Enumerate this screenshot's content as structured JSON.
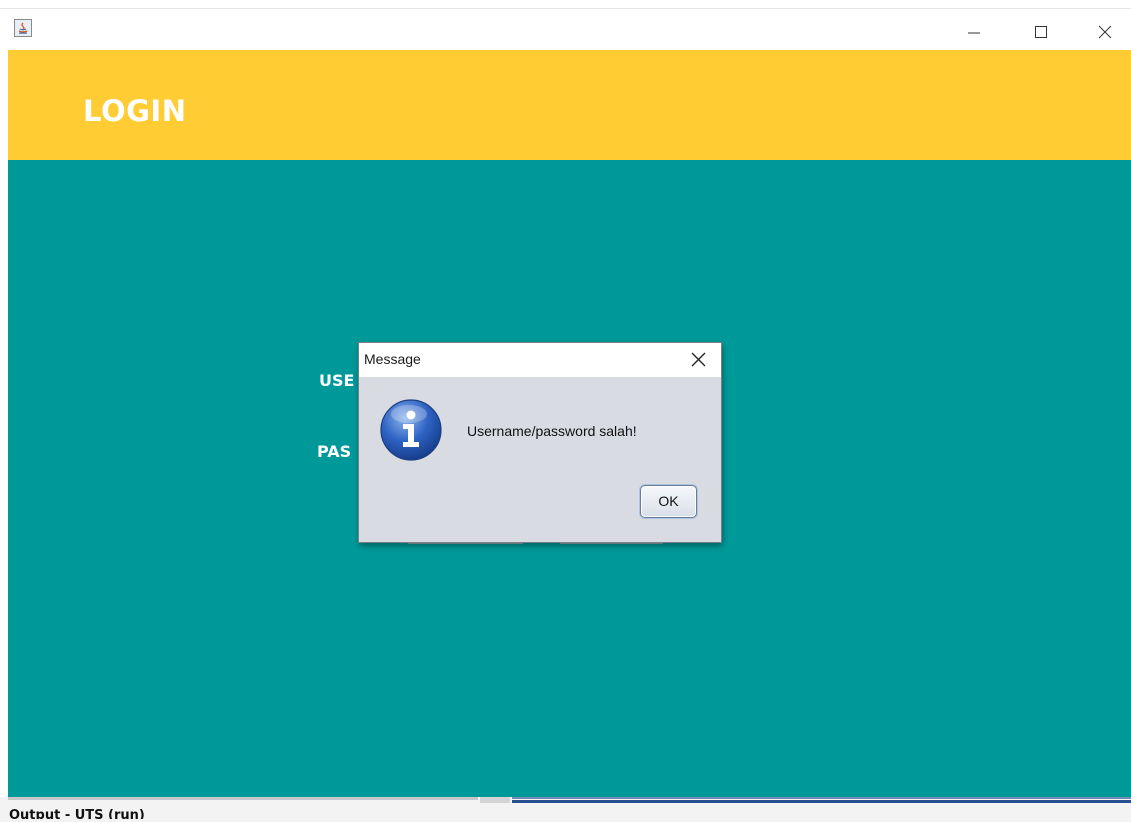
{
  "window": {
    "app_icon": "java-icon",
    "controls": {
      "minimize_icon": "minimize-icon",
      "maximize_icon": "maximize-icon",
      "close_icon": "close-icon"
    }
  },
  "header": {
    "title": "LOGIN",
    "background_color": "#ffcc33"
  },
  "form": {
    "username_label_visible": "USE",
    "password_label_visible": "PAS",
    "background_color": "#009999"
  },
  "dialog": {
    "title": "Message",
    "icon": "info-icon",
    "message": "Username/password salah!",
    "ok_label": "OK",
    "close_icon": "close-icon"
  },
  "bottom_panel": {
    "tab_label": "Output - UTS (run)"
  }
}
